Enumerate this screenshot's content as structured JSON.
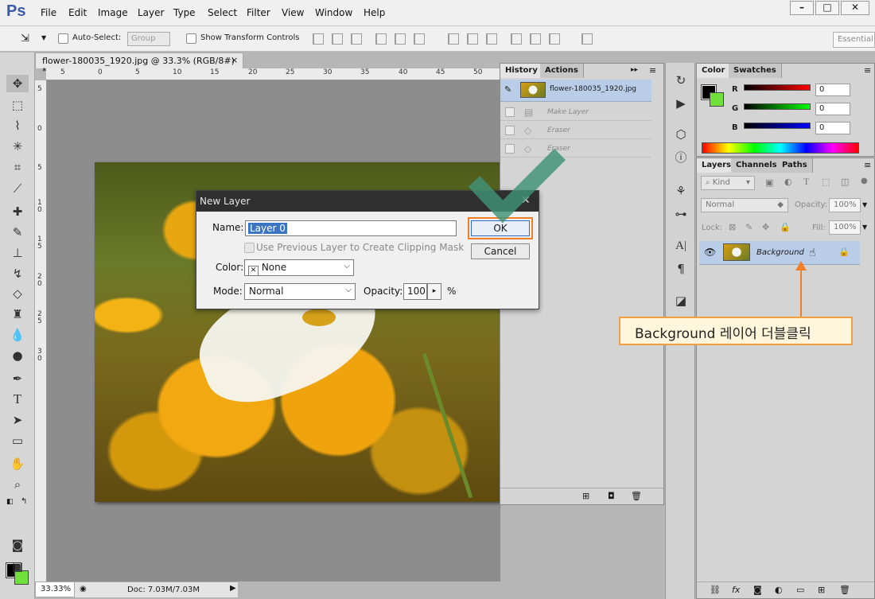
{
  "app": {
    "logo": "Ps"
  },
  "menu": [
    "File",
    "Edit",
    "Image",
    "Layer",
    "Type",
    "Select",
    "Filter",
    "View",
    "Window",
    "Help"
  ],
  "window_controls": [
    "–",
    "□",
    "✕"
  ],
  "options_bar": {
    "auto_select_label": "Auto-Select:",
    "group_value": "Group",
    "show_transform_label": "Show Transform Controls",
    "workspace": "Essential"
  },
  "document_tab": {
    "title": "flower-180035_1920.jpg @ 33.3% (RGB/8#) *",
    "close": "×"
  },
  "ruler_h": [
    "5",
    "0",
    "5",
    "10",
    "15",
    "20",
    "25",
    "30",
    "35",
    "40",
    "45",
    "50"
  ],
  "ruler_v": [
    "5",
    "0",
    "5",
    "1\n0",
    "1\n5",
    "2\n0",
    "2\n5",
    "3\n0"
  ],
  "status": {
    "zoom": "33.33%",
    "doc": "Doc: 7.03M/7.03M"
  },
  "history_panel": {
    "tabs": [
      "History",
      "Actions"
    ],
    "snapshot": "flower-180035_1920.jpg",
    "items": [
      "Make Layer",
      "Eraser",
      "Eraser"
    ]
  },
  "color_panel": {
    "tabs": [
      "Color",
      "Swatches"
    ],
    "channels": [
      {
        "label": "R",
        "value": "0"
      },
      {
        "label": "G",
        "value": "0"
      },
      {
        "label": "B",
        "value": "0"
      }
    ],
    "fg": "#000000",
    "bg": "#6fe03c"
  },
  "layers_panel": {
    "tabs": [
      "Layers",
      "Channels",
      "Paths"
    ],
    "kind_label": "Kind",
    "blend_mode": "Normal",
    "opacity_label": "Opacity:",
    "opacity_value": "100%",
    "lock_label": "Lock:",
    "fill_label": "Fill:",
    "fill_value": "100%",
    "layer_name": "Background"
  },
  "dialog": {
    "title": "New Layer",
    "name_label": "Name:",
    "name_value": "Layer 0",
    "clip_label": "Use Previous Layer to Create Clipping Mask",
    "color_label": "Color:",
    "color_value": "None",
    "mode_label": "Mode:",
    "mode_value": "Normal",
    "opacity_label": "Opacity:",
    "opacity_value": "100",
    "opacity_unit": "%",
    "ok": "OK",
    "cancel": "Cancel"
  },
  "annotation": {
    "text": "Background  레이어 더블클릭"
  }
}
